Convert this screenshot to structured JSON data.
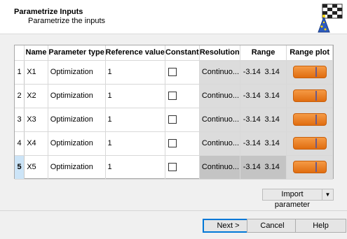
{
  "header": {
    "title": "Parametrize Inputs",
    "subtitle": "Parametrize the inputs",
    "logo_icon": "checkered-flag-wizard-icon"
  },
  "table": {
    "columns": [
      "",
      "Name",
      "Parameter type",
      "Reference value",
      "Constant",
      "Resolution",
      "Range",
      "Range plot"
    ],
    "rows": [
      {
        "index": "1",
        "name": "X1",
        "type": "Optimization",
        "ref": "1",
        "constant": false,
        "resolution": "Continuo...",
        "range_min": "-3.14",
        "range_max": "3.14",
        "selected": false
      },
      {
        "index": "2",
        "name": "X2",
        "type": "Optimization",
        "ref": "1",
        "constant": false,
        "resolution": "Continuo...",
        "range_min": "-3.14",
        "range_max": "3.14",
        "selected": false
      },
      {
        "index": "3",
        "name": "X3",
        "type": "Optimization",
        "ref": "1",
        "constant": false,
        "resolution": "Continuo...",
        "range_min": "-3.14",
        "range_max": "3.14",
        "selected": false
      },
      {
        "index": "4",
        "name": "X4",
        "type": "Optimization",
        "ref": "1",
        "constant": false,
        "resolution": "Continuo...",
        "range_min": "-3.14",
        "range_max": "3.14",
        "selected": false
      },
      {
        "index": "5",
        "name": "X5",
        "type": "Optimization",
        "ref": "1",
        "constant": false,
        "resolution": "Continuo...",
        "range_min": "-3.14",
        "range_max": "3.14",
        "selected": true
      }
    ]
  },
  "import": {
    "label": "Import parameter",
    "dropdown_icon": "triangle-down-icon"
  },
  "footer": {
    "next_label": "Next >",
    "cancel_label": "Cancel",
    "help_label": "Help"
  },
  "colors": {
    "range_bar": "#ef8220",
    "selected_row": "#cce4f7",
    "default_button_border": "#0078d7"
  }
}
